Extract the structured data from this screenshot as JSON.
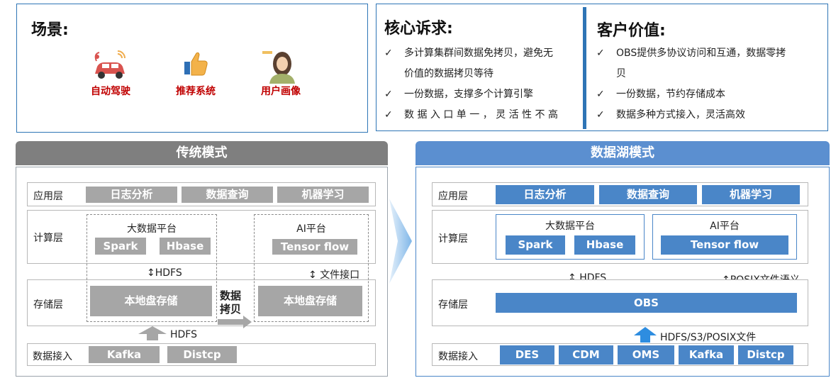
{
  "scenario": {
    "title": "场景:",
    "items": [
      {
        "label": "自动驾驶",
        "icon": "car-wifi-icon"
      },
      {
        "label": "推荐系统",
        "icon": "thumbs-up-icon"
      },
      {
        "label": "用户画像",
        "icon": "user-portrait-icon"
      }
    ]
  },
  "core": {
    "title": "核心诉求:",
    "items": [
      "多计算集群间数据免拷贝，避免无",
      "价值的数据拷贝等待",
      "一份数据，支撑多个计算引擎",
      "数 据 入 口 单 一 ， 灵 活 性 不 高"
    ]
  },
  "value": {
    "title": "客户价值:",
    "items": [
      "OBS提供多协议访问和互通，数据零拷",
      "贝",
      "一份数据，节约存储成本",
      "数据多种方式接入，灵活高效"
    ]
  },
  "traditional": {
    "title": "传统模式",
    "layers": {
      "app": "应用层",
      "compute": "计算层",
      "storage": "存储层",
      "ingest": "数据接入"
    },
    "apps": [
      "日志分析",
      "数据查询",
      "机器学习"
    ],
    "bigdata": {
      "title": "大数据平台",
      "items": [
        "Spark",
        "Hbase"
      ]
    },
    "ai": {
      "title": "AI平台",
      "item": "Tensor flow"
    },
    "hdfs1": "HDFS",
    "file_iface": "文件接口",
    "local1": "本地盘存储",
    "local2": "本地盘存储",
    "copy": "数据拷贝",
    "hdfs2": "HDFS",
    "ingest": [
      "Kafka",
      "Distcp"
    ]
  },
  "lake": {
    "title": "数据湖模式",
    "layers": {
      "app": "应用层",
      "compute": "计算层",
      "storage": "存储层",
      "ingest": "数据接入"
    },
    "apps": [
      "日志分析",
      "数据查询",
      "机器学习"
    ],
    "bigdata": {
      "title": "大数据平台",
      "items": [
        "Spark",
        "Hbase"
      ]
    },
    "ai": {
      "title": "AI平台",
      "item": "Tensor flow"
    },
    "hdfs": "HDFS",
    "posix": "POSIX文件语义",
    "obs": "OBS",
    "ingest_protocols": "HDFS/S3/POSIX文件",
    "ingest": [
      "DES",
      "CDM",
      "OMS",
      "Kafka",
      "Distcp"
    ]
  },
  "colors": {
    "brand_blue": "#2e75b6",
    "box_blue": "#4a86c8",
    "band_blue": "#5b8fd0",
    "band_gray": "#7f7f7f",
    "box_gray": "#a6a6a6",
    "accent_red": "#c00000"
  }
}
